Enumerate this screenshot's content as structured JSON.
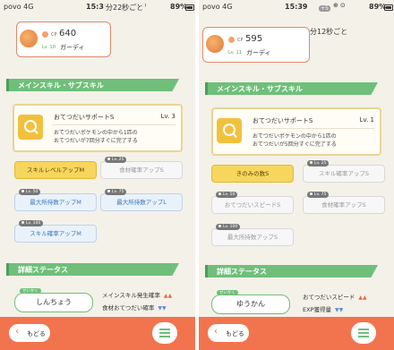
{
  "left": {
    "status": {
      "carrier": "povo 4G",
      "time": "15:39",
      "battery": "89%",
      "badge": "+5"
    },
    "timer": "分22秒ごと",
    "pokemon": {
      "cp_label": "CP",
      "cp": "640",
      "level": "Lv. 10",
      "name": "ガーディ"
    },
    "main_sub_header": "メインスキル・サブスキル",
    "main_skill": {
      "name": "おてつだいサポートS",
      "level": "Lv. 3",
      "desc_line1": "おてつだいポケモンの中から1匹の",
      "desc_line2": "おてつだいが7回分すぐに完了する"
    },
    "sub_skills": [
      {
        "label": "スキルレベルアップM",
        "lv": ""
      },
      {
        "label": "食材確率アップS",
        "lv": "Lv. 25"
      },
      {
        "label": "最大所持数アップM",
        "lv": "Lv. 50"
      },
      {
        "label": "最大所持数アップL",
        "lv": "Lv. 75"
      },
      {
        "label": "スキル確率アップM",
        "lv": "Lv. 100"
      }
    ],
    "detail_header": "詳細ステータス",
    "nature": {
      "small_label": "せいかく",
      "value": "しんちょう"
    },
    "effects": [
      {
        "label": "メインスキル発生確率",
        "arrows": "▲▲"
      },
      {
        "label": "食材おてつだい確率",
        "arrows": "▼▼"
      }
    ],
    "back_label": "もどる"
  },
  "right": {
    "status": {
      "carrier": "povo 4G",
      "time": "15:39",
      "battery": "89%",
      "badge": "+5"
    },
    "timer": "分12秒ごと",
    "pokemon": {
      "cp_label": "CP",
      "cp": "595",
      "level": "Lv. 11",
      "name": "ガーディ"
    },
    "main_sub_header": "メインスキル・サブスキル",
    "main_skill": {
      "name": "おてつだいサポートS",
      "level": "Lv. 1",
      "desc_line1": "おてつだいポケモンの中から1匹の",
      "desc_line2": "おてつだいが5回分すぐに完了する"
    },
    "sub_skills": [
      {
        "label": "きのみの数S",
        "lv": ""
      },
      {
        "label": "スキル確率アップS",
        "lv": "Lv. 25"
      },
      {
        "label": "おてつだいスピードS",
        "lv": "Lv. 50"
      },
      {
        "label": "食材確率アップS",
        "lv": "Lv. 75"
      },
      {
        "label": "最大所持数アップS",
        "lv": "Lv. 100"
      }
    ],
    "detail_header": "詳細ステータス",
    "nature": {
      "small_label": "せいかく",
      "value": "ゆうかん"
    },
    "effects": [
      {
        "label": "おてつだいスピード",
        "arrows": "▲▲"
      },
      {
        "label": "EXP獲得量",
        "arrows": "▼▼"
      }
    ],
    "back_label": "もどる"
  },
  "colors": {
    "header_green": "#6fbf7a",
    "bottom_orange": "#f2744e",
    "gold": "#f7d65e",
    "skill_blue": "#3b74b8"
  }
}
